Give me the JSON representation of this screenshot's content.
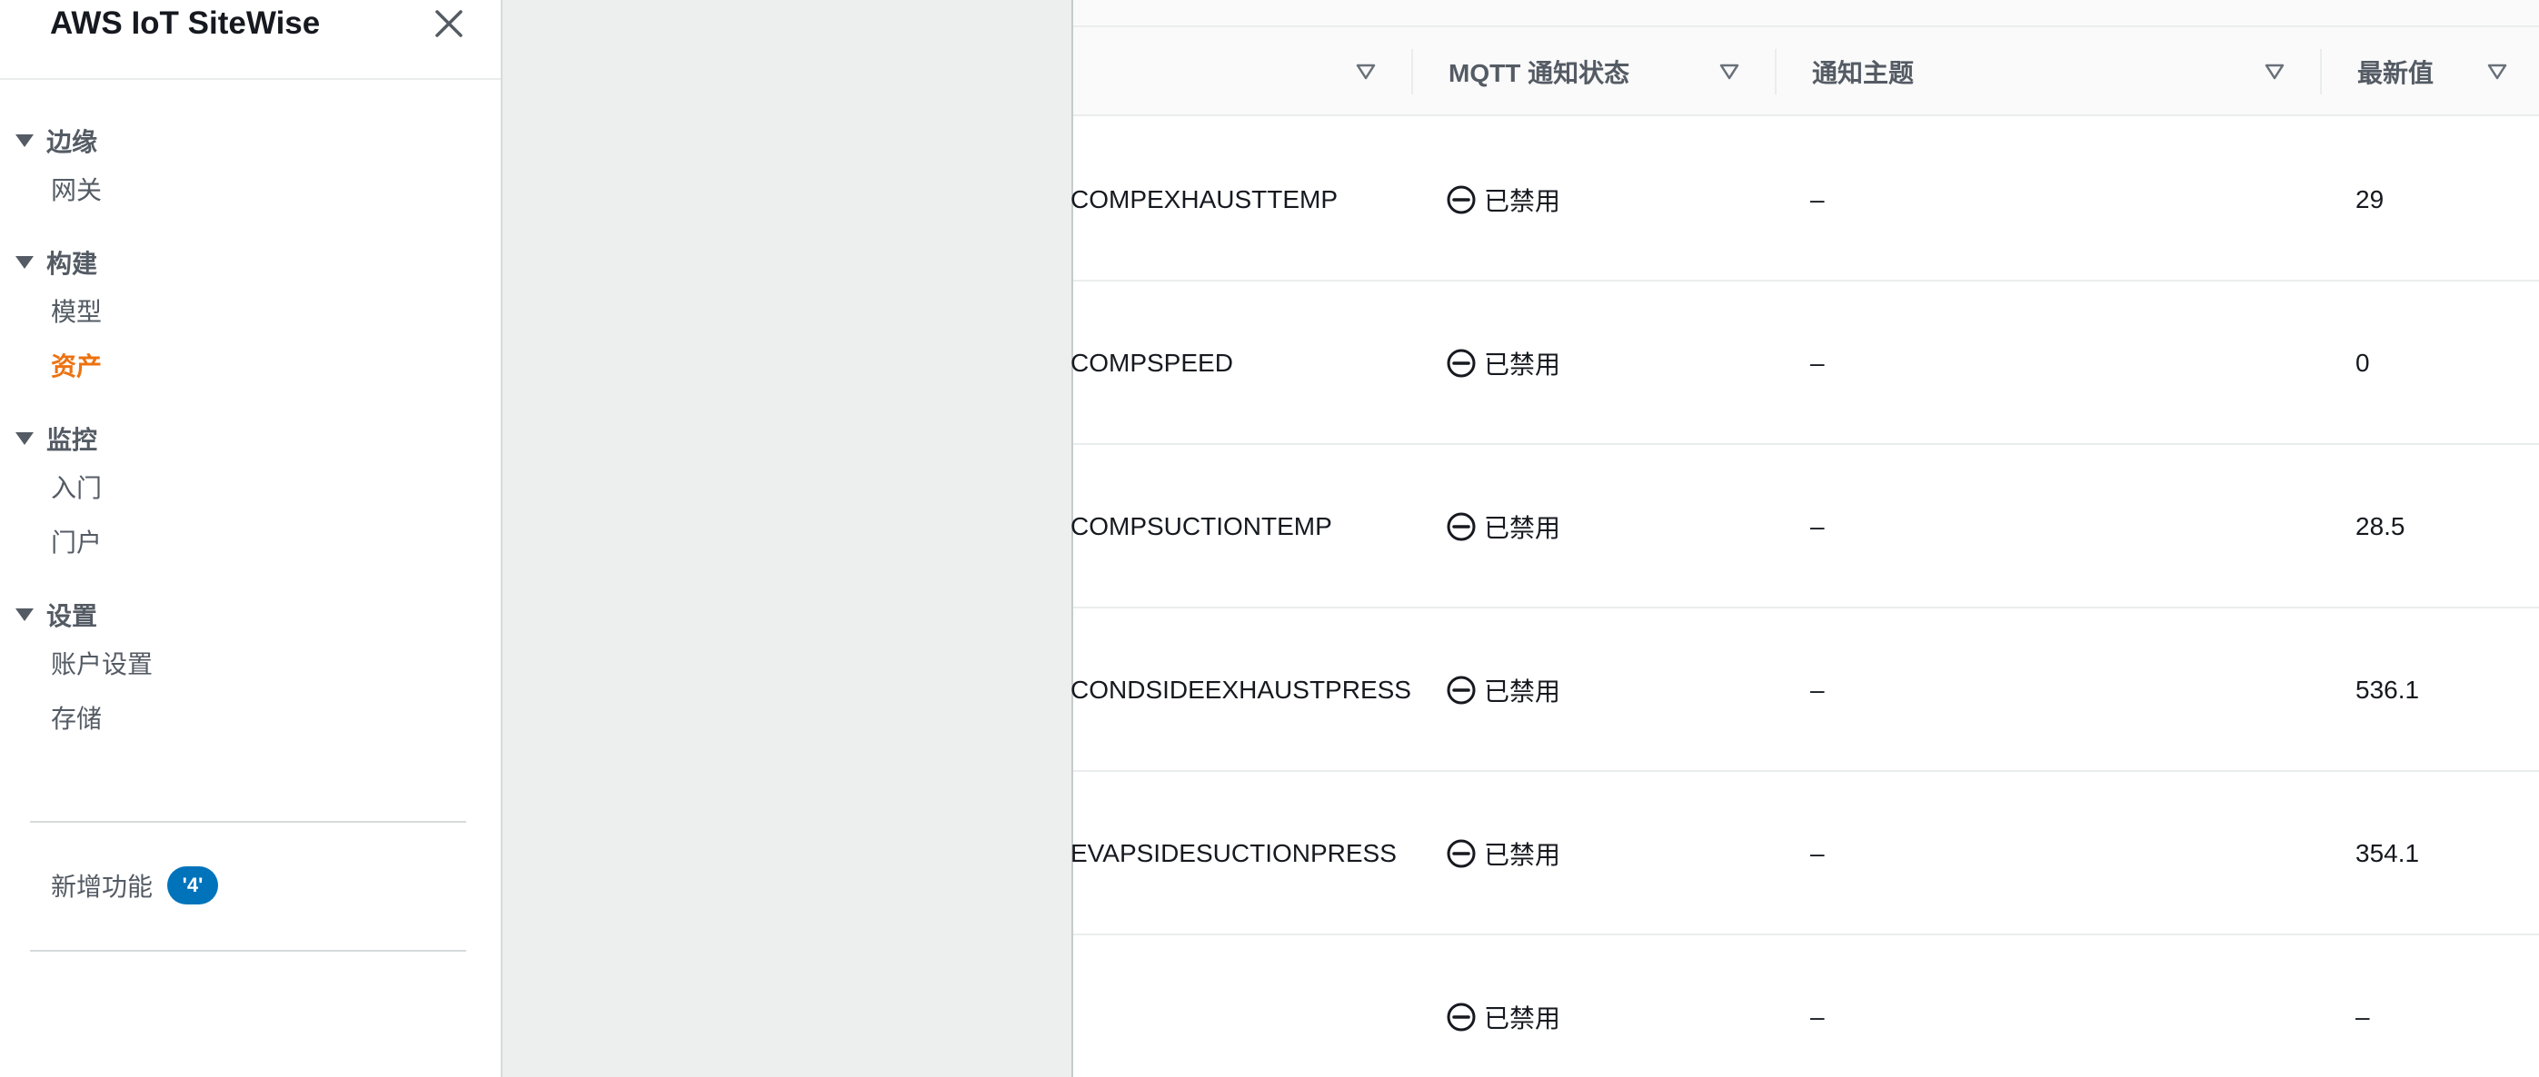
{
  "sidebar": {
    "title": "AWS IoT SiteWise",
    "sections": [
      {
        "label": "边缘",
        "items": [
          {
            "label": "网关",
            "active": false
          }
        ]
      },
      {
        "label": "构建",
        "items": [
          {
            "label": "模型",
            "active": false
          },
          {
            "label": "资产",
            "active": true
          }
        ]
      },
      {
        "label": "监控",
        "items": [
          {
            "label": "入门",
            "active": false
          },
          {
            "label": "门户",
            "active": false
          }
        ]
      },
      {
        "label": "设置",
        "items": [
          {
            "label": "账户设置",
            "active": false
          },
          {
            "label": "存储",
            "active": false
          }
        ]
      }
    ],
    "whats_new": {
      "label": "新增功能",
      "badge": "'4'"
    },
    "active_color": "#ec7211",
    "badge_color": "#0073bb"
  },
  "table": {
    "columns": [
      {
        "label": ""
      },
      {
        "label": "MQTT 通知状态"
      },
      {
        "label": "通知主题"
      },
      {
        "label": "最新值"
      }
    ],
    "rows": [
      {
        "name": "COMPEXHAUSTTEMP",
        "status": "已禁用",
        "topic": "–",
        "latest": "29"
      },
      {
        "name": "COMPSPEED",
        "status": "已禁用",
        "topic": "–",
        "latest": "0"
      },
      {
        "name": "COMPSUCTIONTEMP",
        "status": "已禁用",
        "topic": "–",
        "latest": "28.5"
      },
      {
        "name": "CONDSIDEEXHAUSTPRESS",
        "status": "已禁用",
        "topic": "–",
        "latest": "536.1"
      },
      {
        "name": "EVAPSIDESUCTIONPRESS",
        "status": "已禁用",
        "topic": "–",
        "latest": "354.1"
      },
      {
        "name": "",
        "status": "已禁用",
        "topic": "–",
        "latest": "–"
      }
    ],
    "icons": {
      "status": "disabled-minus-circle-icon",
      "sort": "sort-triangle-icon"
    }
  }
}
